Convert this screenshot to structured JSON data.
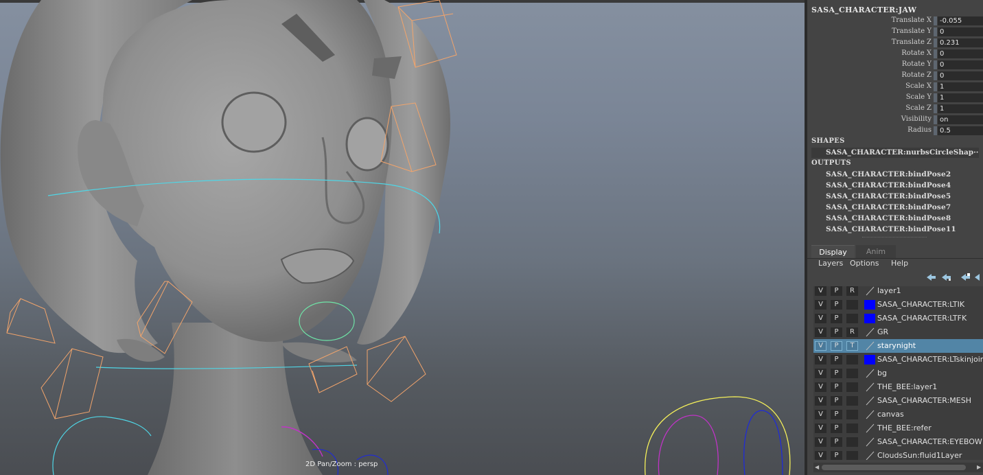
{
  "viewport": {
    "label": "2D Pan/Zoom : persp"
  },
  "attribute_editor": {
    "node_name": "SASA_CHARACTER:JAW",
    "attributes": [
      {
        "label": "Translate X",
        "value": "-0.055"
      },
      {
        "label": "Translate Y",
        "value": "0"
      },
      {
        "label": "Translate Z",
        "value": "0.231"
      },
      {
        "label": "Rotate X",
        "value": "0"
      },
      {
        "label": "Rotate Y",
        "value": "0"
      },
      {
        "label": "Rotate Z",
        "value": "0"
      },
      {
        "label": "Scale X",
        "value": "1"
      },
      {
        "label": "Scale Y",
        "value": "1"
      },
      {
        "label": "Scale Z",
        "value": "1"
      },
      {
        "label": "Visibility",
        "value": "on"
      },
      {
        "label": "Radius",
        "value": "0.5"
      }
    ],
    "shapes_header": "SHAPES",
    "shape_item": "SASA_CHARACTER:nurbsCircleShap···",
    "outputs_header": "OUTPUTS",
    "outputs": [
      "SASA_CHARACTER:bindPose2",
      "SASA_CHARACTER:bindPose4",
      "SASA_CHARACTER:bindPose5",
      "SASA_CHARACTER:bindPose7",
      "SASA_CHARACTER:bindPose8",
      "SASA_CHARACTER:bindPose11"
    ]
  },
  "layer_editor": {
    "tabs": [
      {
        "label": "Display",
        "active": true
      },
      {
        "label": "Anim",
        "active": false
      }
    ],
    "menu": [
      "Layers",
      "Options",
      "Help"
    ],
    "tool_icons": [
      "move-layer-up-icon",
      "move-layer-down-icon",
      "new-layer-selected-icon",
      "new-layer-icon"
    ],
    "colors": {
      "selected_row": "#5285a6",
      "swatch_blue": "#0000ff"
    },
    "layers": [
      {
        "name": "layer1",
        "v": "V",
        "p": "P",
        "t": "R",
        "swatch": "none",
        "selected": false
      },
      {
        "name": "SASA_CHARACTER:LTIK",
        "v": "V",
        "p": "P",
        "t": "",
        "swatch": "#0000ff",
        "selected": false
      },
      {
        "name": "SASA_CHARACTER:LTFK",
        "v": "V",
        "p": "P",
        "t": "",
        "swatch": "#0000ff",
        "selected": false
      },
      {
        "name": "GR",
        "v": "V",
        "p": "P",
        "t": "R",
        "swatch": "none",
        "selected": false
      },
      {
        "name": "starynight",
        "v": "V",
        "p": "P",
        "t": "T",
        "swatch": "none",
        "selected": true
      },
      {
        "name": "SASA_CHARACTER:LTskinjoint",
        "v": "V",
        "p": "P",
        "t": "",
        "swatch": "#0000ff",
        "selected": false
      },
      {
        "name": "bg",
        "v": "V",
        "p": "P",
        "t": "",
        "swatch": "none",
        "selected": false
      },
      {
        "name": "THE_BEE:layer1",
        "v": "V",
        "p": "P",
        "t": "",
        "swatch": "none",
        "selected": false
      },
      {
        "name": "SASA_CHARACTER:MESH",
        "v": "V",
        "p": "P",
        "t": "",
        "swatch": "none",
        "selected": false
      },
      {
        "name": "canvas",
        "v": "V",
        "p": "P",
        "t": "",
        "swatch": "none",
        "selected": false
      },
      {
        "name": "THE_BEE:refer",
        "v": "V",
        "p": "P",
        "t": "",
        "swatch": "none",
        "selected": false
      },
      {
        "name": "SASA_CHARACTER:EYEBOW",
        "v": "V",
        "p": "P",
        "t": "",
        "swatch": "none",
        "selected": false
      },
      {
        "name": "CloudsSun:fluid1Layer",
        "v": "V",
        "p": "P",
        "t": "",
        "swatch": "none",
        "selected": false
      }
    ]
  }
}
